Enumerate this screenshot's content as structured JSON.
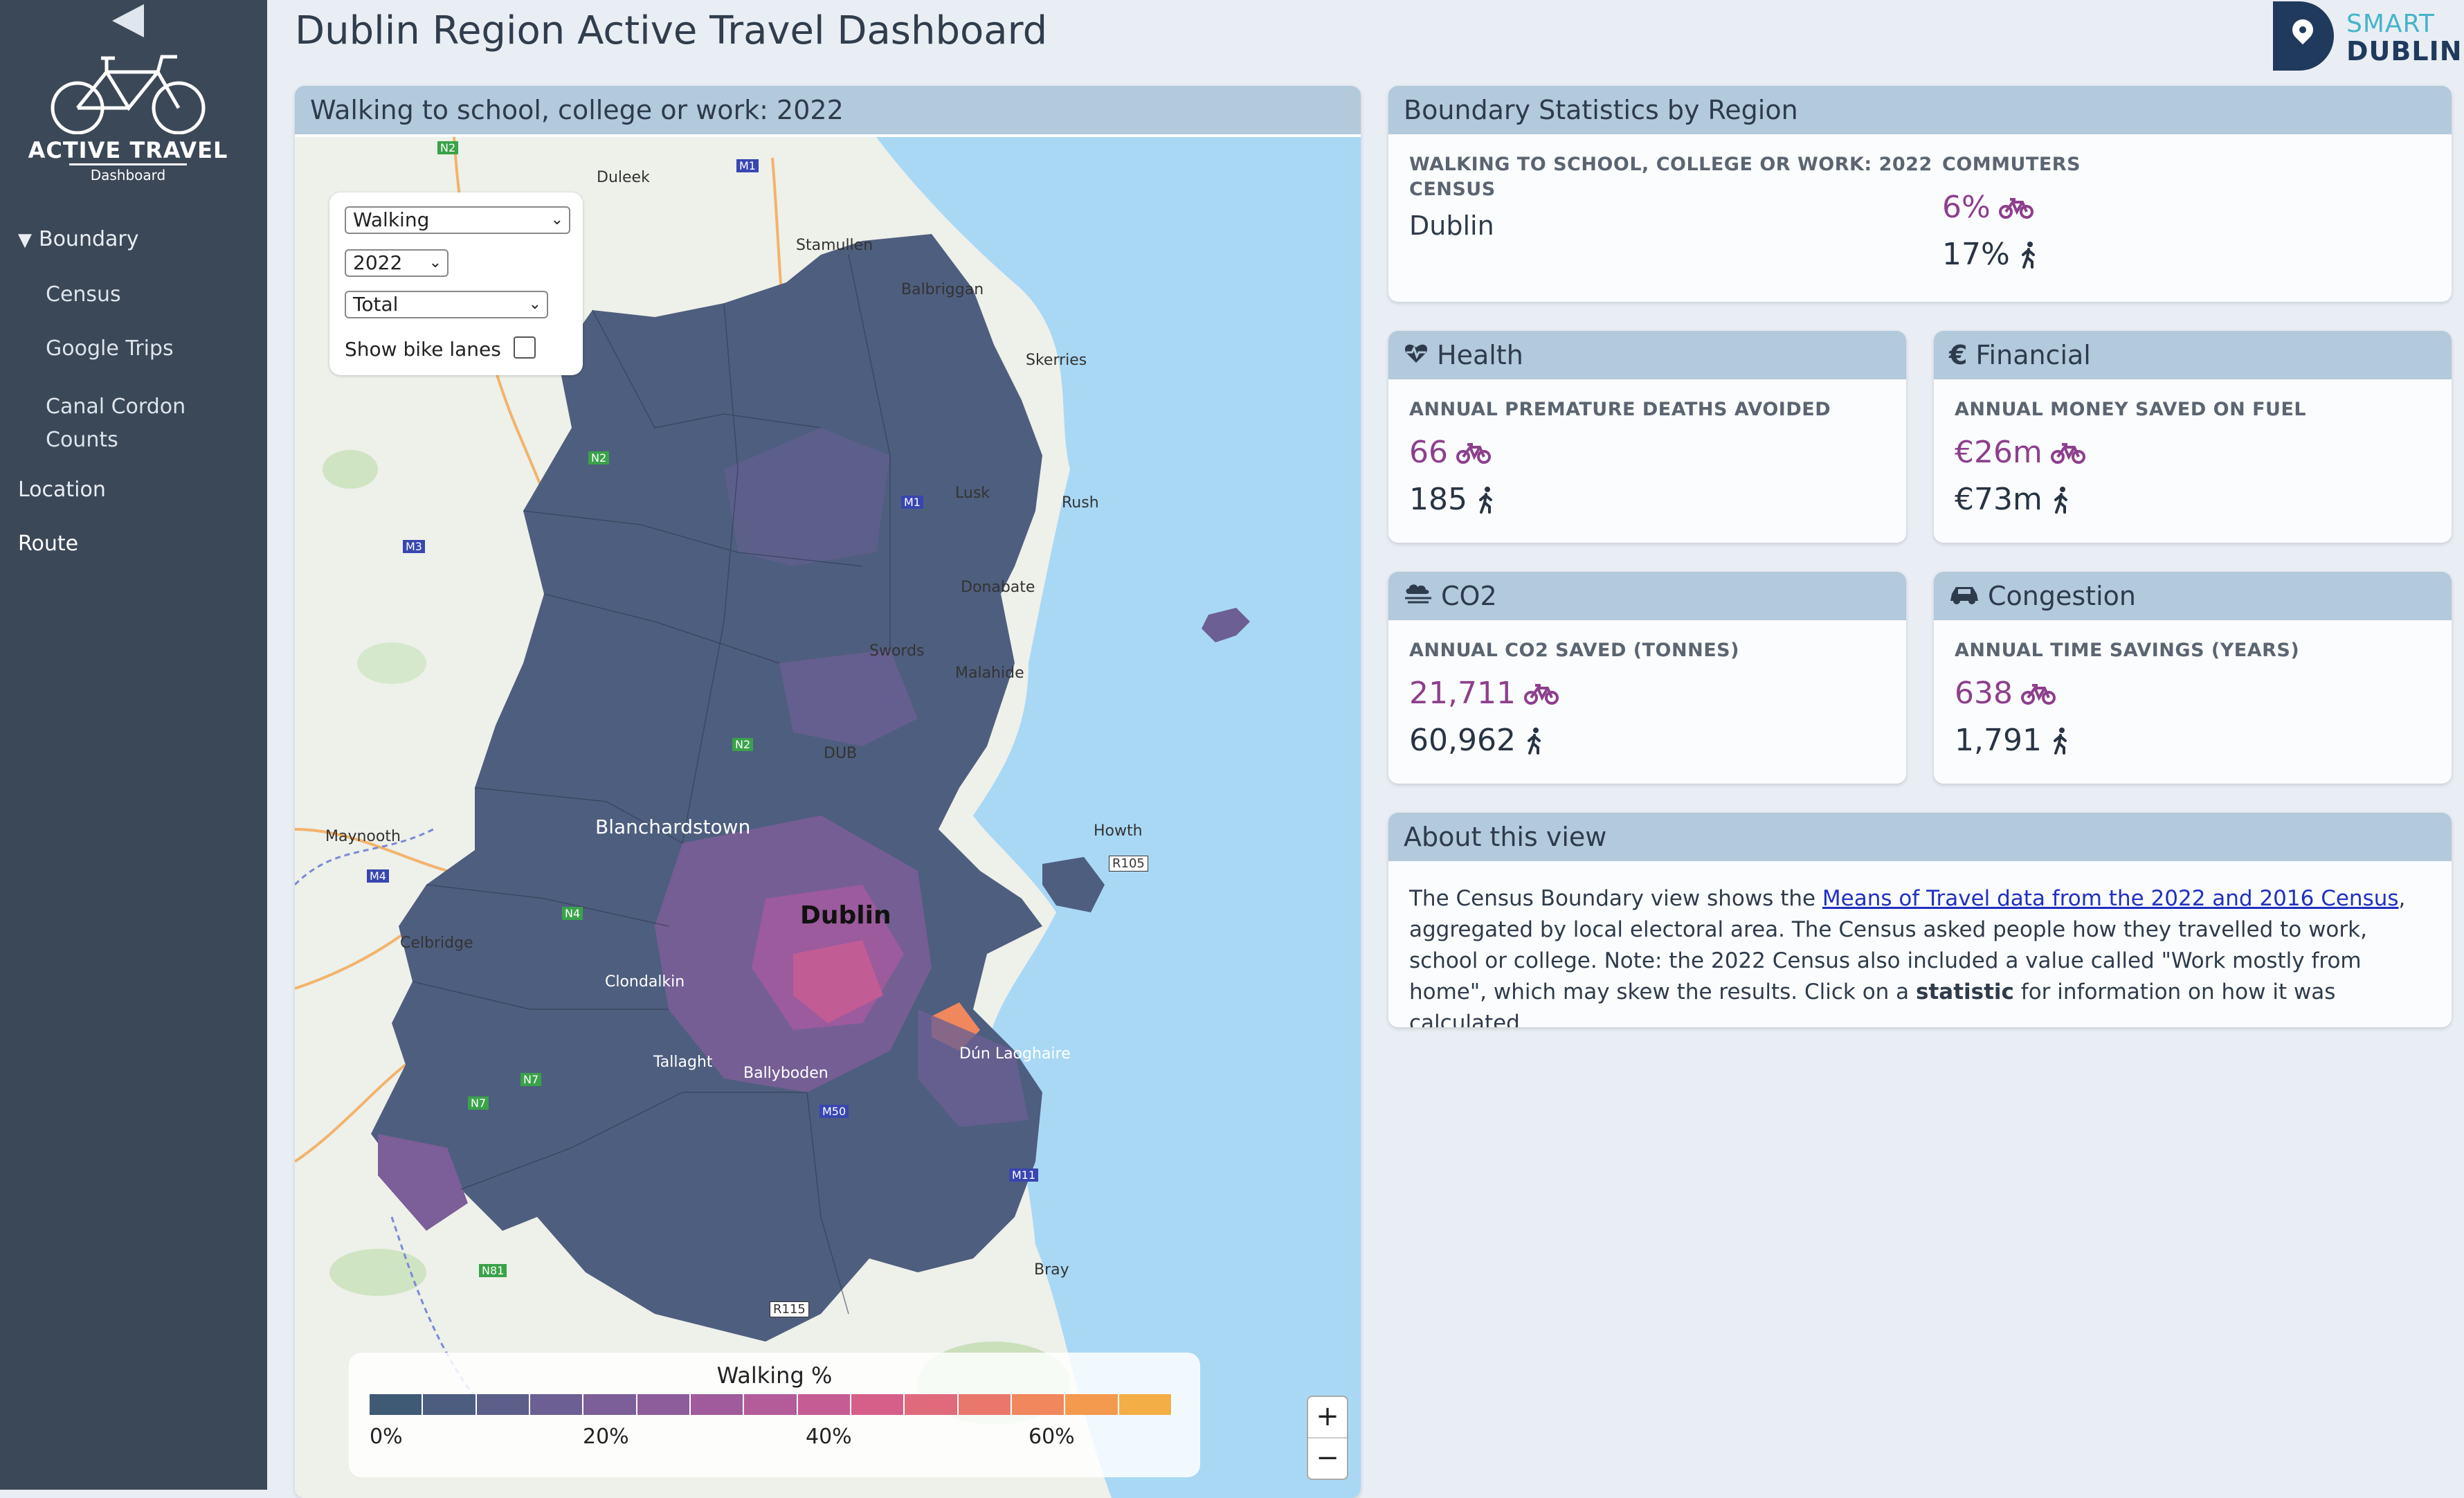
{
  "sidebar": {
    "logo_title": "ACTIVE TRAVEL",
    "logo_sub": "Dashboard",
    "group_label": "Boundary",
    "sub_items": [
      "Census",
      "Google Trips",
      "Canal Cordon",
      "Counts"
    ],
    "items": [
      "Location",
      "Route"
    ]
  },
  "header": {
    "title": "Dublin Region Active Travel Dashboard",
    "logo_line1": "SMART",
    "logo_line2": "DUBLIN"
  },
  "map": {
    "title": "Walking to school, college or work: 2022",
    "mode_select": "Walking",
    "year_select": "2022",
    "group_select": "Total",
    "bike_lanes_label": "Show bike lanes",
    "bike_lanes_checked": false,
    "legend_title": "Walking %",
    "legend_ticks": [
      "0%",
      "20%",
      "40%",
      "60%"
    ],
    "legend_colors": [
      "#3e5a75",
      "#4c5d80",
      "#5b5f8a",
      "#6b5f93",
      "#7c5e98",
      "#8d5c9b",
      "#a05b9c",
      "#b45b9a",
      "#c65c94",
      "#d65f8a",
      "#e1697c",
      "#ea776c",
      "#f0875d",
      "#f39a4e",
      "#f4ae46"
    ],
    "zoom_in": "+",
    "zoom_out": "−",
    "places": [
      "Duleek",
      "Stamullen",
      "Balbriggan",
      "Skerries",
      "Lusk",
      "Rush",
      "Donabate",
      "Swords",
      "Malahide",
      "DUB",
      "Howth",
      "R105",
      "Blanchardstown",
      "Maynooth",
      "Dublin",
      "Celbridge",
      "Clondalkin",
      "Tallaght",
      "Ballyboden",
      "Dún Laoghaire",
      "Bray",
      "R115"
    ],
    "road_shields": [
      "N2",
      "M1",
      "N2",
      "M3",
      "M1",
      "N2",
      "M4",
      "N4",
      "N7",
      "N7",
      "M50",
      "M11",
      "N81"
    ]
  },
  "boundary": {
    "title": "Boundary Statistics by Region",
    "left_label_line1": "WALKING TO SCHOOL, COLLEGE OR WORK: 2022",
    "left_label_line2": "CENSUS",
    "region": "Dublin",
    "right_label": "COMMUTERS",
    "bike_value": "6%",
    "walk_value": "17%"
  },
  "health": {
    "title": "Health",
    "label": "ANNUAL PREMATURE DEATHS AVOIDED",
    "bike": "66",
    "walk": "185"
  },
  "financial": {
    "title": "Financial",
    "label": "ANNUAL MONEY SAVED ON FUEL",
    "bike": "€26m",
    "walk": "€73m"
  },
  "co2": {
    "title": "CO2",
    "label": "ANNUAL CO2 SAVED (TONNES)",
    "bike": "21,711",
    "walk": "60,962"
  },
  "congestion": {
    "title": "Congestion",
    "label": "ANNUAL TIME SAVINGS (YEARS)",
    "bike": "638",
    "walk": "1,791"
  },
  "about": {
    "title": "About this view",
    "text_before": "The Census Boundary view shows the ",
    "link_text": "Means of Travel data from the 2022 and 2016 Census",
    "text_after": ", aggregated by local electoral area. The Census asked people how they travelled to work, school or college. Note: the 2022 Census also included a value called \"Work mostly from home\", which may skew the results. Click on a ",
    "bold_text": "statistic",
    "text_end": " for information on how it was calculated."
  },
  "colors": {
    "sidebar": "#3b4857",
    "card_header": "#b3c9dc",
    "bike": "#8d3f8d",
    "walk": "#283444",
    "sea": "#a9d8f5"
  }
}
